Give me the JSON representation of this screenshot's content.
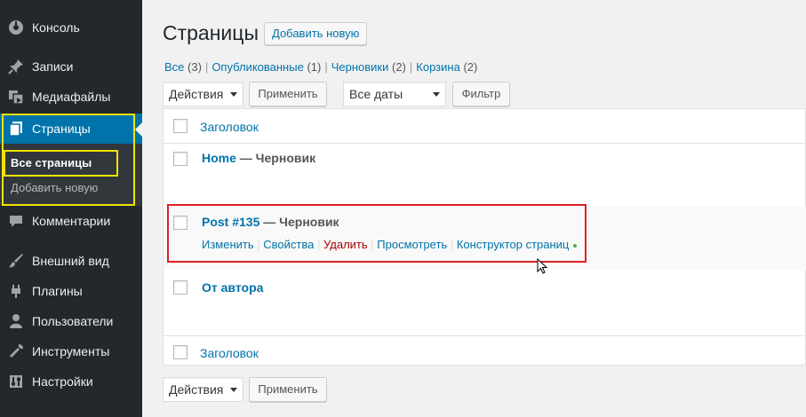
{
  "sidebar": {
    "items": [
      {
        "label": "Консоль",
        "icon": "dashboard-icon"
      },
      {
        "label": "Записи",
        "icon": "pin-icon"
      },
      {
        "label": "Медиафайлы",
        "icon": "media-icon"
      },
      {
        "label": "Страницы",
        "icon": "pages-icon"
      },
      {
        "label": "Комментарии",
        "icon": "comments-icon"
      },
      {
        "label": "Внешний вид",
        "icon": "brush-icon"
      },
      {
        "label": "Плагины",
        "icon": "plugin-icon"
      },
      {
        "label": "Пользователи",
        "icon": "users-icon"
      },
      {
        "label": "Инструменты",
        "icon": "tools-icon"
      },
      {
        "label": "Настройки",
        "icon": "settings-icon"
      }
    ],
    "submenu": {
      "all_pages": "Все страницы",
      "add_new": "Добавить новую"
    }
  },
  "main": {
    "title": "Страницы",
    "add_new": "Добавить новую",
    "filters": {
      "all": {
        "label": "Все",
        "count": "(3)"
      },
      "published": {
        "label": "Опубликованные",
        "count": "(1)"
      },
      "drafts": {
        "label": "Черновики",
        "count": "(2)"
      },
      "trash": {
        "label": "Корзина",
        "count": "(2)"
      },
      "separator": "|"
    },
    "bulk_actions": "Действия",
    "apply": "Применить",
    "dates": "Все даты",
    "filter": "Фильтр",
    "column_title": "Заголовок",
    "rows": [
      {
        "title": "Home",
        "state": " — Черновик"
      },
      {
        "title": "Post #135",
        "state": " — Черновик"
      },
      {
        "title": "От автора",
        "state": ""
      }
    ],
    "row_actions": {
      "edit": "Изменить",
      "quick_edit": "Свойства",
      "trash": "Удалить",
      "view": "Просмотреть",
      "builder": "Конструктор страниц",
      "separator": "|"
    }
  },
  "colors": {
    "sidebar": "#23282d",
    "accent": "#0073aa",
    "delete": "#a00",
    "highlight_yellow": "#f0e400",
    "highlight_red": "#e02020",
    "status_dot": "#46b450"
  }
}
